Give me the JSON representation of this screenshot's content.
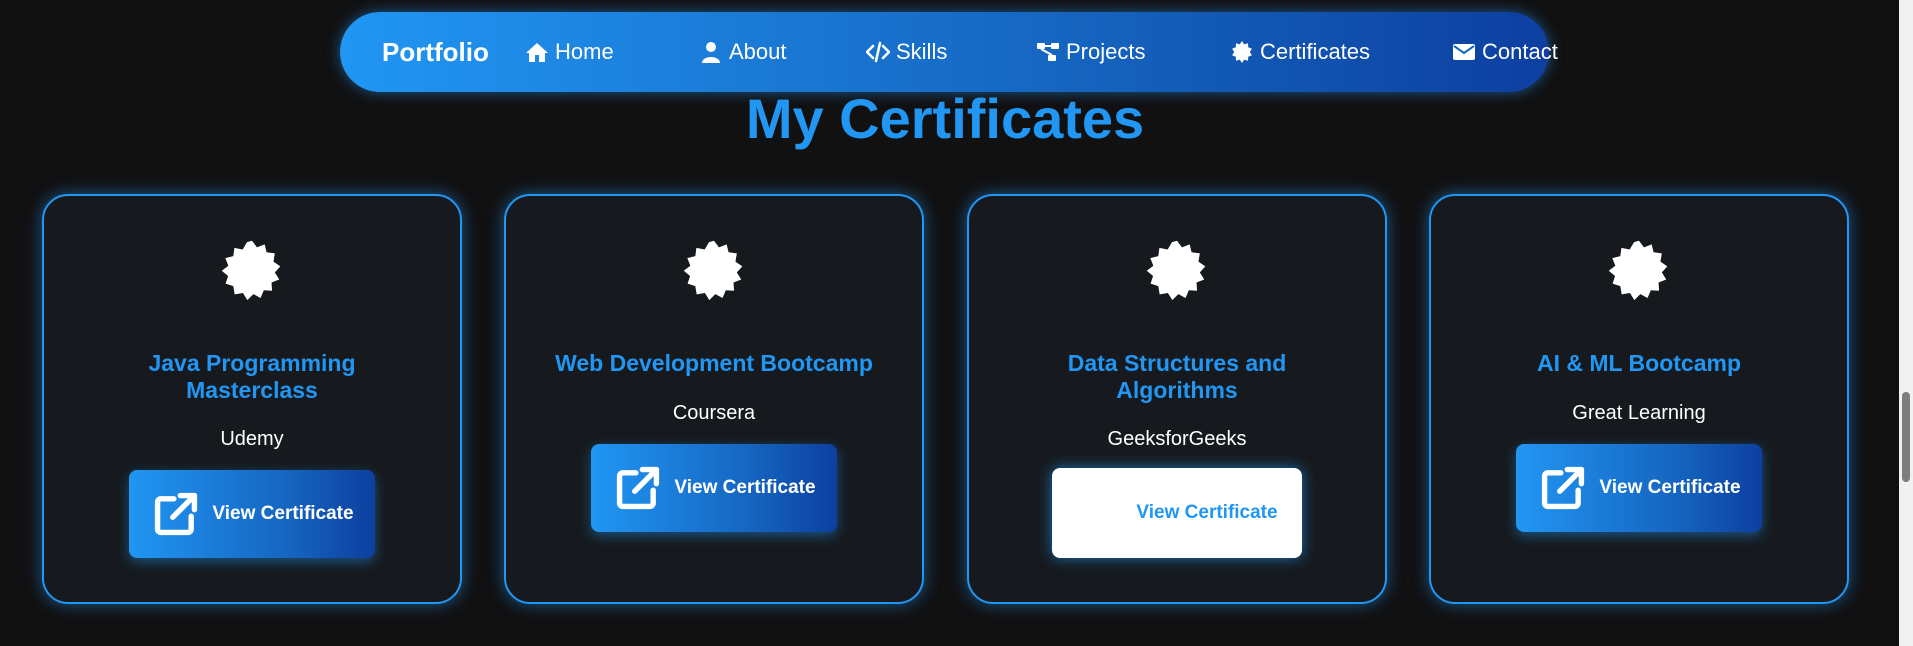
{
  "navbar": {
    "brand": "Portfolio",
    "items": [
      {
        "label": "Home",
        "icon": "home-icon"
      },
      {
        "label": "About",
        "icon": "user-icon"
      },
      {
        "label": "Skills",
        "icon": "code-icon"
      },
      {
        "label": "Projects",
        "icon": "sitemap-icon"
      },
      {
        "label": "Certificates",
        "icon": "certificate-icon"
      },
      {
        "label": "Contact",
        "icon": "envelope-icon"
      }
    ]
  },
  "page": {
    "title": "My Certificates"
  },
  "certificates": [
    {
      "title": "Java Programming Masterclass",
      "issuer": "Udemy",
      "button": "View Certificate"
    },
    {
      "title": "Web Development Bootcamp",
      "issuer": "Coursera",
      "button": "View Certificate"
    },
    {
      "title": "Data Structures and Algorithms",
      "issuer": "GeeksforGeeks",
      "button": "View Certificate"
    },
    {
      "title": "AI & ML Bootcamp",
      "issuer": "Great Learning",
      "button": "View Certificate"
    }
  ],
  "colors": {
    "accent": "#2196f3",
    "accent_dark": "#0d3fa0",
    "background": "#111112",
    "card_background": "#161a1e"
  }
}
